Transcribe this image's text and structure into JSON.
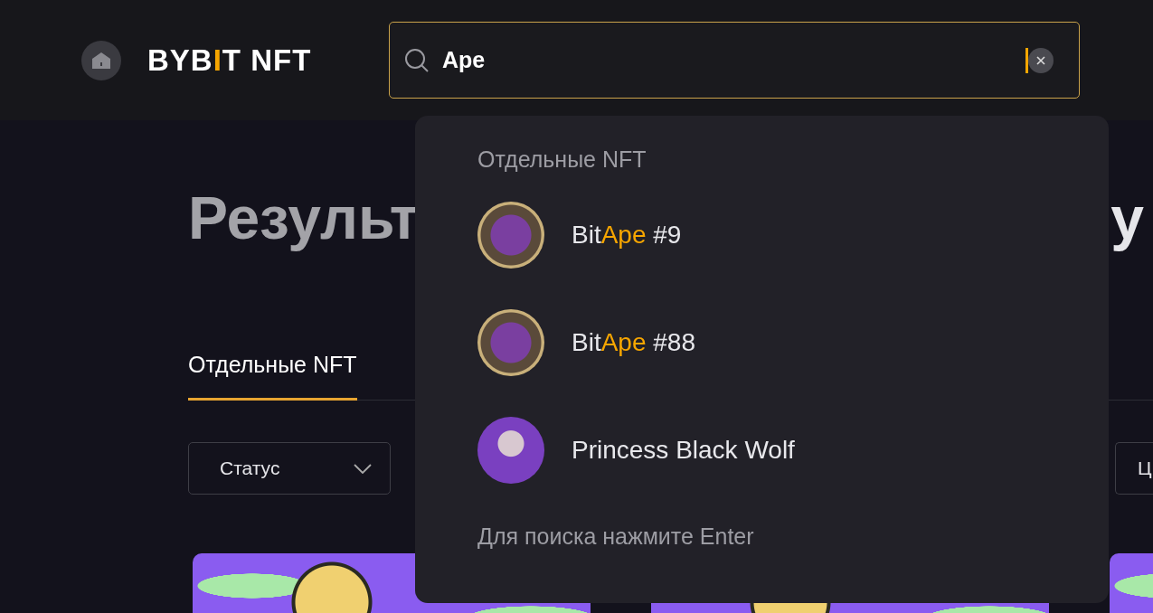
{
  "header": {
    "logo": [
      {
        "text": "BYB",
        "accent": false
      },
      {
        "text": "I",
        "accent": true
      },
      {
        "text": "T",
        "accent": false
      },
      {
        "text": " NFT",
        "accent": false
      }
    ],
    "search": {
      "value": "Ape",
      "focused": true
    }
  },
  "heading": {
    "visible_start": "Результ",
    "visible_end": "у"
  },
  "tabs": [
    {
      "label": "Отдельные NFT",
      "selected": true
    }
  ],
  "filters": [
    {
      "label": "Статус",
      "kind": "dropdown"
    },
    {
      "label": "Ц",
      "kind": "partial"
    }
  ],
  "result_cards": [
    {
      "kind": "artwork"
    },
    {
      "kind": "artwork"
    },
    {
      "kind": "artwork"
    }
  ],
  "suggestions": {
    "section_title": "Отдельные NFT",
    "items": [
      {
        "kind": "ape",
        "name_parts": [
          {
            "text": "Bit",
            "highlight": false
          },
          {
            "text": "Ape",
            "highlight": true
          },
          {
            "text": " #9",
            "highlight": false
          }
        ]
      },
      {
        "kind": "ape",
        "name_parts": [
          {
            "text": "Bit",
            "highlight": false
          },
          {
            "text": "Ape",
            "highlight": true
          },
          {
            "text": " #88",
            "highlight": false
          }
        ]
      },
      {
        "kind": "wolf",
        "name_parts": [
          {
            "text": "Princess Black Wolf",
            "highlight": false
          }
        ]
      }
    ],
    "hint": "Для поиска нажмите Enter"
  }
}
